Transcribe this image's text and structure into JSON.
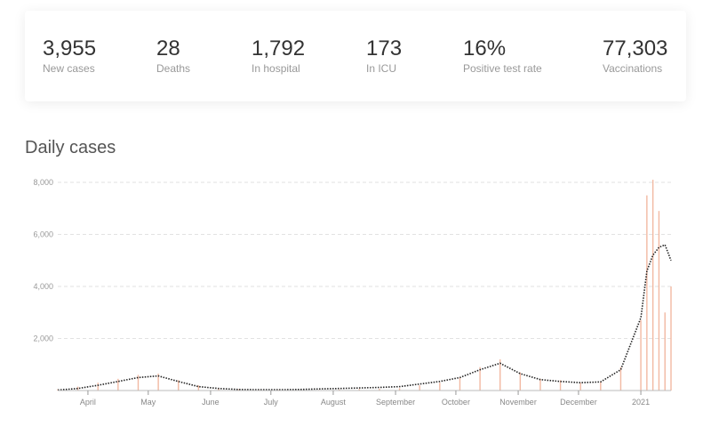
{
  "stats": [
    {
      "value": "3,955",
      "label": "New cases"
    },
    {
      "value": "28",
      "label": "Deaths"
    },
    {
      "value": "1,792",
      "label": "In hospital"
    },
    {
      "value": "173",
      "label": "In ICU"
    },
    {
      "value": "16%",
      "label": "Positive test rate"
    },
    {
      "value": "77,303",
      "label": "Vaccinations"
    }
  ],
  "chart_title": "Daily cases",
  "chart_data": {
    "type": "bar",
    "title": "Daily cases",
    "xlabel": "",
    "ylabel": "",
    "ylim": [
      0,
      8000
    ],
    "yticks": [
      2000,
      4000,
      6000,
      8000
    ],
    "ytick_labels": [
      "2,000",
      "4,000",
      "6,000",
      "8,000"
    ],
    "xtick_labels": [
      "April",
      "May",
      "June",
      "July",
      "August",
      "September",
      "October",
      "November",
      "December",
      "2021"
    ],
    "xtick_days": [
      15,
      45,
      76,
      106,
      137,
      168,
      198,
      229,
      259,
      290
    ],
    "grid": true,
    "bar_color": "#f2b9a2",
    "line_color": "#222222",
    "series": [
      {
        "kind": "bar",
        "days": [
          0,
          10,
          20,
          30,
          40,
          50,
          60,
          70,
          80,
          90,
          100,
          110,
          120,
          130,
          140,
          150,
          160,
          170,
          180,
          190,
          200,
          210,
          220,
          230,
          240,
          250,
          260,
          270,
          280,
          290,
          293,
          296,
          299,
          302,
          305
        ],
        "values": [
          50,
          150,
          300,
          450,
          600,
          650,
          400,
          200,
          100,
          50,
          40,
          30,
          20,
          25,
          40,
          60,
          70,
          90,
          200,
          300,
          500,
          900,
          1200,
          700,
          450,
          400,
          300,
          350,
          900,
          2700,
          7500,
          8100,
          6900,
          3000,
          4000
        ]
      },
      {
        "kind": "line",
        "days": [
          0,
          10,
          20,
          30,
          40,
          50,
          60,
          70,
          80,
          90,
          100,
          110,
          120,
          130,
          140,
          150,
          160,
          170,
          180,
          190,
          200,
          210,
          220,
          230,
          240,
          250,
          260,
          270,
          280,
          290,
          293,
          296,
          299,
          302,
          305
        ],
        "values": [
          20,
          80,
          200,
          350,
          500,
          560,
          350,
          150,
          80,
          40,
          30,
          30,
          40,
          60,
          80,
          100,
          120,
          150,
          250,
          350,
          500,
          800,
          1050,
          650,
          420,
          350,
          300,
          330,
          800,
          2800,
          4600,
          5200,
          5500,
          5600,
          5000
        ]
      }
    ]
  }
}
